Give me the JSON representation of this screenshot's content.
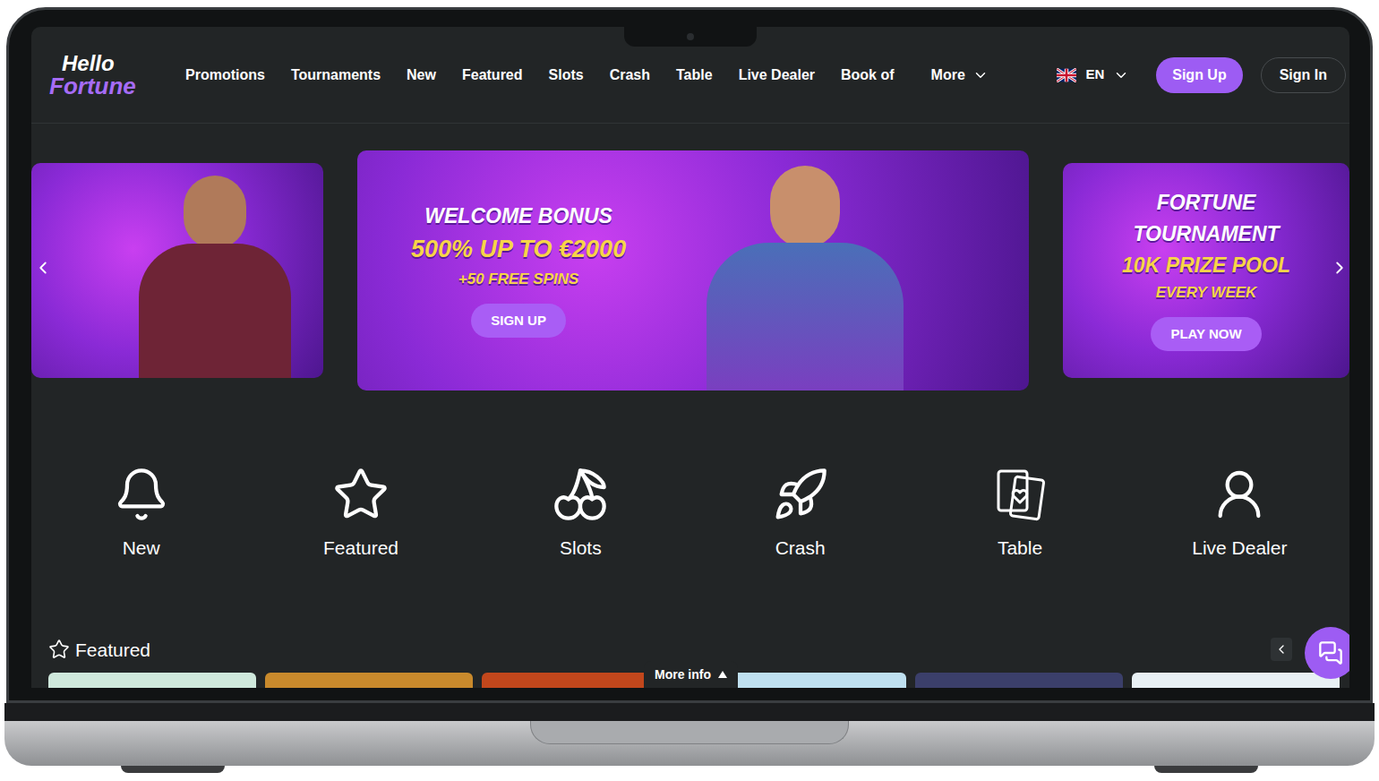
{
  "logo": {
    "top": "Hello",
    "bottom": "Fortune"
  },
  "nav": {
    "items": [
      "Promotions",
      "Tournaments",
      "New",
      "Featured",
      "Slots",
      "Crash",
      "Table",
      "Live Dealer",
      "Book of"
    ],
    "more": "More"
  },
  "language": {
    "code": "EN"
  },
  "auth": {
    "sign_up": "Sign Up",
    "sign_in": "Sign In"
  },
  "carousel": {
    "slides": [
      {
        "kind": "photo",
        "selected": false
      },
      {
        "kind": "promo",
        "selected": true,
        "lines": [
          "WELCOME BONUS",
          "500% UP TO €2000",
          "+50 FREE SPINS"
        ],
        "button": "SIGN UP"
      },
      {
        "kind": "promo",
        "selected": false,
        "lines": [
          "FORTUNE",
          "TOURNAMENT",
          "10K PRIZE POOL",
          "EVERY WEEK"
        ],
        "button": "PLAY NOW"
      }
    ]
  },
  "categories": [
    {
      "label": "New"
    },
    {
      "label": "Featured"
    },
    {
      "label": "Slots"
    },
    {
      "label": "Crash"
    },
    {
      "label": "Table"
    },
    {
      "label": "Live Dealer"
    }
  ],
  "featured": {
    "title": "Featured",
    "more_info": "More info"
  }
}
